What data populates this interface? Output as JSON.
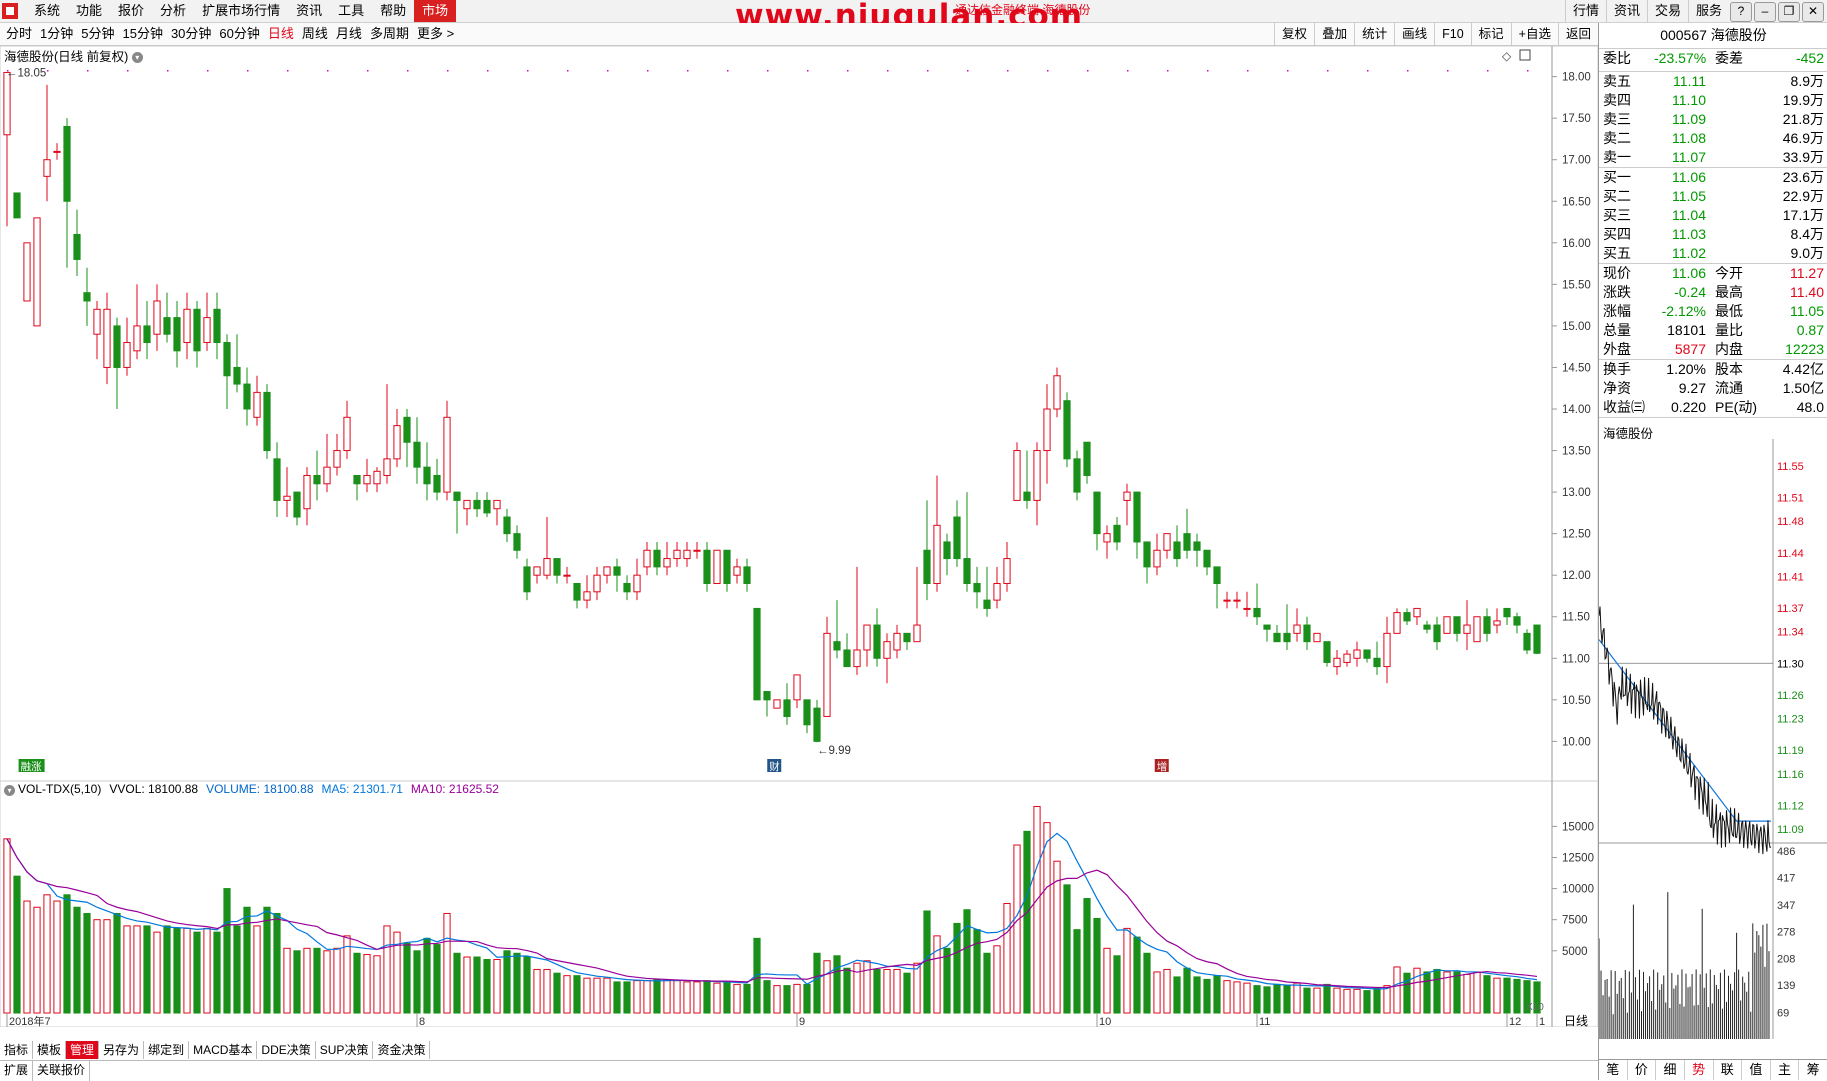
{
  "menu": {
    "items": [
      "系统",
      "功能",
      "报价",
      "分析",
      "扩展市场行情",
      "资讯",
      "工具",
      "帮助",
      "市场"
    ],
    "active": "市场",
    "watermark": "www.niugulan.com",
    "overlay_title": "通达信金融终端 海德股份",
    "right_buttons": [
      "行情",
      "资讯",
      "交易",
      "服务"
    ]
  },
  "toolbar": {
    "periods": [
      "分时",
      "1分钟",
      "5分钟",
      "15分钟",
      "30分钟",
      "60分钟",
      "日线",
      "周线",
      "月线",
      "多周期",
      "更多 >"
    ],
    "active_period": "日线",
    "tools": [
      "复权",
      "叠加",
      "统计",
      "画线",
      "F10",
      "标记",
      "+自选",
      "返回"
    ]
  },
  "chart": {
    "title": "海德股份(日线 前复权)",
    "high_label": "18.05",
    "low_label": "9.99",
    "badges": [
      "融涨",
      "财",
      "增"
    ],
    "month_labels": [
      "2018年7",
      "8",
      "9",
      "10",
      "11",
      "12",
      "1"
    ],
    "period_label": "日线",
    "zoom_label": "X10"
  },
  "chart_data": {
    "type": "candlestick",
    "title": "海德股份(日线 前复权)",
    "price_axis": {
      "min": 9.8,
      "max": 18.2,
      "ticks": [
        "18.00",
        "17.50",
        "17.00",
        "16.50",
        "16.00",
        "15.50",
        "15.00",
        "14.50",
        "14.00",
        "13.50",
        "13.00",
        "12.50",
        "12.00",
        "11.50",
        "11.00",
        "10.50",
        "10.00"
      ]
    },
    "volume_axis": {
      "max": 17200,
      "ticks": [
        "15000",
        "12500",
        "10000",
        "7500",
        "5000"
      ]
    },
    "candles": [
      [
        17.3,
        18.05,
        16.3,
        16.2,
        14000
      ],
      [
        16.6,
        16.3,
        15.9,
        16.7,
        11000
      ],
      [
        15.3,
        16.0,
        14.9,
        15.9,
        9000
      ],
      [
        15.0,
        16.3,
        15.0,
        16.3,
        8500
      ],
      [
        16.8,
        17.0,
        17.9,
        16.5,
        9500
      ],
      [
        17.1,
        17.1,
        17.2,
        17.0,
        9000
      ],
      [
        17.4,
        16.5,
        17.5,
        15.7,
        9500
      ],
      [
        16.1,
        15.8,
        16.4,
        15.6,
        8500
      ],
      [
        15.4,
        15.3,
        15.7,
        15.0,
        8000
      ],
      [
        14.9,
        15.2,
        15.3,
        14.6,
        7500
      ],
      [
        14.5,
        15.2,
        15.4,
        14.3,
        7500
      ],
      [
        15.0,
        14.5,
        15.1,
        14.0,
        8000
      ],
      [
        14.5,
        14.8,
        15.1,
        14.4,
        7000
      ],
      [
        14.7,
        15.0,
        15.5,
        14.6,
        7000
      ],
      [
        15.0,
        14.8,
        15.3,
        14.6,
        7000
      ],
      [
        14.9,
        15.3,
        15.5,
        14.7,
        6500
      ],
      [
        15.1,
        14.9,
        15.4,
        14.8,
        7000
      ],
      [
        15.1,
        14.7,
        15.3,
        14.5,
        6800
      ],
      [
        14.8,
        15.2,
        15.4,
        14.6,
        6800
      ],
      [
        15.2,
        14.7,
        15.3,
        14.5,
        6500
      ],
      [
        14.8,
        15.1,
        15.4,
        14.7,
        6800
      ],
      [
        15.2,
        14.8,
        15.4,
        14.6,
        6500
      ],
      [
        14.8,
        14.4,
        14.9,
        14.0,
        10000
      ],
      [
        14.5,
        14.3,
        14.9,
        14.2,
        7000
      ],
      [
        14.3,
        14.0,
        14.5,
        13.8,
        8500
      ],
      [
        13.9,
        14.2,
        14.4,
        13.8,
        7000
      ],
      [
        14.2,
        13.5,
        14.3,
        13.4,
        8500
      ],
      [
        13.4,
        12.9,
        13.6,
        12.7,
        8000
      ],
      [
        12.9,
        12.95,
        13.3,
        12.7,
        5200
      ],
      [
        13.0,
        12.7,
        13.0,
        12.6,
        5000
      ],
      [
        12.8,
        13.2,
        13.3,
        12.6,
        5200
      ],
      [
        13.2,
        13.1,
        13.5,
        12.9,
        5200
      ],
      [
        13.1,
        13.3,
        13.7,
        13.0,
        5000
      ],
      [
        13.3,
        13.5,
        13.7,
        13.2,
        5200
      ],
      [
        13.5,
        13.9,
        14.1,
        13.4,
        6200
      ],
      [
        13.2,
        13.1,
        13.2,
        12.9,
        4800
      ],
      [
        13.1,
        13.2,
        13.4,
        13.0,
        4700
      ],
      [
        13.1,
        13.25,
        13.3,
        13.0,
        4600
      ],
      [
        13.2,
        13.4,
        14.3,
        13.1,
        7000
      ],
      [
        13.4,
        13.8,
        14.0,
        13.3,
        6500
      ],
      [
        13.9,
        13.6,
        14.0,
        13.3,
        5600
      ],
      [
        13.6,
        13.3,
        13.9,
        13.1,
        5000
      ],
      [
        13.3,
        13.1,
        13.6,
        12.9,
        6000
      ],
      [
        13.2,
        13.0,
        13.4,
        12.9,
        5500
      ],
      [
        13.0,
        13.9,
        14.1,
        12.9,
        8000
      ],
      [
        13.0,
        12.9,
        13.0,
        12.5,
        4800
      ],
      [
        12.8,
        12.9,
        12.9,
        12.6,
        4500
      ],
      [
        12.9,
        12.8,
        13.0,
        12.7,
        4500
      ],
      [
        12.9,
        12.75,
        13.0,
        12.7,
        4300
      ],
      [
        12.8,
        12.9,
        12.9,
        12.6,
        4300
      ],
      [
        12.7,
        12.5,
        12.8,
        12.4,
        5000
      ],
      [
        12.5,
        12.3,
        12.6,
        12.2,
        4800
      ],
      [
        12.1,
        11.8,
        12.2,
        11.7,
        4500
      ],
      [
        12.0,
        12.1,
        12.1,
        11.9,
        3500
      ],
      [
        12.0,
        12.2,
        12.7,
        11.95,
        3500
      ],
      [
        12.2,
        12.0,
        12.2,
        11.9,
        3200
      ],
      [
        12.0,
        12.0,
        12.1,
        11.9,
        3000
      ],
      [
        11.9,
        11.7,
        11.9,
        11.6,
        3000
      ],
      [
        11.7,
        11.8,
        12.0,
        11.6,
        2800
      ],
      [
        11.8,
        12.0,
        12.1,
        11.7,
        2800
      ],
      [
        12.0,
        12.1,
        12.1,
        11.9,
        2800
      ],
      [
        12.1,
        12.0,
        12.2,
        11.8,
        2500
      ],
      [
        11.9,
        11.8,
        12.0,
        11.7,
        2500
      ],
      [
        11.8,
        12.0,
        12.2,
        11.7,
        2600
      ],
      [
        12.1,
        12.3,
        12.4,
        12.0,
        2600
      ],
      [
        12.3,
        12.1,
        12.4,
        12.0,
        2700
      ],
      [
        12.1,
        12.2,
        12.4,
        12.0,
        2600
      ],
      [
        12.2,
        12.3,
        12.4,
        12.1,
        2600
      ],
      [
        12.2,
        12.3,
        12.4,
        12.1,
        2500
      ],
      [
        12.3,
        12.3,
        12.4,
        12.2,
        2500
      ],
      [
        12.3,
        11.9,
        12.4,
        11.8,
        2600
      ],
      [
        11.9,
        12.3,
        12.3,
        11.9,
        2400
      ],
      [
        12.3,
        11.9,
        12.3,
        11.8,
        2500
      ],
      [
        12.0,
        12.1,
        12.2,
        11.9,
        2300
      ],
      [
        12.1,
        11.9,
        12.2,
        11.8,
        2300
      ],
      [
        11.6,
        10.5,
        11.6,
        10.5,
        6000
      ],
      [
        10.6,
        10.5,
        10.6,
        10.3,
        2600
      ],
      [
        10.4,
        10.5,
        10.5,
        10.4,
        2200
      ],
      [
        10.5,
        10.3,
        10.7,
        10.2,
        2200
      ],
      [
        10.5,
        10.8,
        10.8,
        10.4,
        2300
      ],
      [
        10.5,
        10.2,
        10.5,
        10.1,
        2300
      ],
      [
        10.4,
        10.0,
        10.5,
        9.99,
        4800
      ],
      [
        10.3,
        11.3,
        11.5,
        10.3,
        4200
      ],
      [
        11.2,
        11.1,
        11.7,
        11.0,
        4600
      ],
      [
        11.1,
        10.9,
        11.3,
        10.9,
        3600
      ],
      [
        10.9,
        11.1,
        12.1,
        10.8,
        4000
      ],
      [
        11.1,
        11.4,
        11.4,
        10.9,
        4200
      ],
      [
        11.4,
        11.0,
        11.6,
        10.9,
        3500
      ],
      [
        11.0,
        11.2,
        11.3,
        10.7,
        3500
      ],
      [
        11.1,
        11.3,
        11.4,
        11.0,
        3500
      ],
      [
        11.3,
        11.2,
        11.3,
        11.1,
        3200
      ],
      [
        11.2,
        11.4,
        12.1,
        11.2,
        4000
      ],
      [
        12.3,
        11.9,
        12.9,
        11.7,
        8200
      ],
      [
        11.9,
        12.6,
        13.2,
        11.8,
        6200
      ],
      [
        12.4,
        12.2,
        12.5,
        12.0,
        5200
      ],
      [
        12.7,
        12.2,
        12.9,
        12.1,
        7200
      ],
      [
        12.2,
        11.9,
        13.0,
        11.8,
        8300
      ],
      [
        11.9,
        11.8,
        12.1,
        11.6,
        6700
      ],
      [
        11.7,
        11.6,
        12.1,
        11.5,
        4800
      ],
      [
        11.7,
        11.9,
        12.1,
        11.6,
        5400
      ],
      [
        11.9,
        12.2,
        12.4,
        11.8,
        8800
      ],
      [
        12.9,
        13.5,
        13.6,
        12.9,
        13500
      ],
      [
        13.0,
        12.9,
        13.5,
        12.8,
        14600
      ],
      [
        12.9,
        13.5,
        13.6,
        12.6,
        16600
      ],
      [
        13.5,
        14.0,
        14.3,
        13.1,
        15300
      ],
      [
        14.0,
        14.4,
        14.5,
        13.9,
        12200
      ],
      [
        14.1,
        13.4,
        14.2,
        13.3,
        10300
      ],
      [
        13.4,
        13.0,
        13.5,
        12.9,
        6700
      ],
      [
        13.6,
        13.2,
        13.6,
        13.1,
        9200
      ],
      [
        13.0,
        12.5,
        13.0,
        12.3,
        7600
      ],
      [
        12.4,
        12.5,
        12.6,
        12.2,
        5200
      ],
      [
        12.6,
        12.4,
        12.7,
        12.3,
        4600
      ],
      [
        12.9,
        13.0,
        13.1,
        12.6,
        6800
      ],
      [
        13.0,
        12.4,
        13.0,
        12.2,
        6100
      ],
      [
        12.4,
        12.1,
        12.4,
        11.9,
        4800
      ],
      [
        12.1,
        12.3,
        12.5,
        12.0,
        3300
      ],
      [
        12.3,
        12.5,
        12.5,
        12.2,
        3500
      ],
      [
        12.4,
        12.2,
        12.6,
        12.1,
        2900
      ],
      [
        12.5,
        12.3,
        12.8,
        12.2,
        3600
      ],
      [
        12.4,
        12.3,
        12.5,
        12.1,
        2900
      ],
      [
        12.3,
        12.1,
        12.3,
        12.0,
        2700
      ],
      [
        12.1,
        11.9,
        12.1,
        11.6,
        3000
      ],
      [
        11.7,
        11.7,
        11.8,
        11.6,
        2600
      ],
      [
        11.7,
        11.7,
        11.8,
        11.6,
        2500
      ],
      [
        11.6,
        11.6,
        11.8,
        11.5,
        2400
      ],
      [
        11.6,
        11.5,
        11.9,
        11.4,
        2200
      ],
      [
        11.4,
        11.35,
        11.4,
        11.2,
        2100
      ],
      [
        11.3,
        11.2,
        11.4,
        11.2,
        2300
      ],
      [
        11.3,
        11.2,
        11.65,
        11.1,
        2200
      ],
      [
        11.3,
        11.4,
        11.6,
        11.2,
        2400
      ],
      [
        11.4,
        11.2,
        11.5,
        11.1,
        2000
      ],
      [
        11.2,
        11.3,
        11.3,
        11.2,
        2000
      ],
      [
        11.2,
        10.95,
        11.2,
        10.9,
        2300
      ],
      [
        10.9,
        11.0,
        11.1,
        10.8,
        2000
      ],
      [
        10.95,
        11.05,
        11.1,
        10.9,
        1900
      ],
      [
        11.0,
        11.1,
        11.2,
        10.9,
        1900
      ],
      [
        11.1,
        11.0,
        11.1,
        10.95,
        1800
      ],
      [
        11.0,
        10.9,
        11.2,
        10.8,
        2000
      ],
      [
        10.9,
        11.3,
        11.5,
        10.7,
        2200
      ],
      [
        11.3,
        11.55,
        11.6,
        11.3,
        3700
      ],
      [
        11.55,
        11.45,
        11.6,
        11.4,
        3200
      ],
      [
        11.5,
        11.6,
        11.6,
        11.4,
        3600
      ],
      [
        11.4,
        11.35,
        11.45,
        11.3,
        3300
      ],
      [
        11.4,
        11.2,
        11.5,
        11.1,
        3500
      ],
      [
        11.3,
        11.5,
        11.5,
        11.3,
        3300
      ],
      [
        11.5,
        11.3,
        11.5,
        11.2,
        3300
      ],
      [
        11.3,
        11.4,
        11.7,
        11.1,
        3100
      ],
      [
        11.2,
        11.5,
        11.5,
        11.2,
        3300
      ],
      [
        11.5,
        11.3,
        11.6,
        11.2,
        3000
      ],
      [
        11.4,
        11.45,
        11.6,
        11.3,
        2800
      ],
      [
        11.6,
        11.5,
        11.6,
        11.4,
        2800
      ],
      [
        11.5,
        11.4,
        11.55,
        11.3,
        2700
      ],
      [
        11.3,
        11.1,
        11.35,
        11.05,
        2600
      ],
      [
        11.4,
        11.06,
        11.4,
        11.05,
        2500
      ]
    ]
  },
  "volume": {
    "legend_name": "VOL-TDX(5,10)",
    "vvol": "VVOL: 18100.88",
    "volume": "VOLUME: 18100.88",
    "ma5": "MA5: 21301.71",
    "ma10": "MA10: 21625.52",
    "colors": {
      "volume": "#0066cc",
      "ma5": "#0077dd",
      "ma10": "#990099"
    }
  },
  "bottom": {
    "tabs1": [
      "指标",
      "模板",
      "管理",
      "另存为",
      "绑定到",
      "MACD基本",
      "DDE决策",
      "SUP决策",
      "资金决策"
    ],
    "active_tab1": "管理",
    "tabs2": [
      "扩展",
      "关联报价"
    ]
  },
  "quote": {
    "code_name": "000567 海德股份",
    "weibi_label": "委比",
    "weibi": "-23.57%",
    "weicha_label": "委差",
    "weicha": "-452",
    "sells": [
      {
        "label": "卖五",
        "price": "11.11",
        "vol": "8.9万"
      },
      {
        "label": "卖四",
        "price": "11.10",
        "vol": "19.9万"
      },
      {
        "label": "卖三",
        "price": "11.09",
        "vol": "21.8万"
      },
      {
        "label": "卖二",
        "price": "11.08",
        "vol": "46.9万"
      },
      {
        "label": "卖一",
        "price": "11.07",
        "vol": "33.9万"
      }
    ],
    "buys": [
      {
        "label": "买一",
        "price": "11.06",
        "vol": "23.6万"
      },
      {
        "label": "买二",
        "price": "11.05",
        "vol": "22.9万"
      },
      {
        "label": "买三",
        "price": "11.04",
        "vol": "17.1万"
      },
      {
        "label": "买四",
        "price": "11.03",
        "vol": "8.4万"
      },
      {
        "label": "买五",
        "price": "11.02",
        "vol": "9.0万"
      }
    ],
    "stats": [
      {
        "l1": "现价",
        "v1": "11.06",
        "c1": "g",
        "l2": "今开",
        "v2": "11.27",
        "c2": "r"
      },
      {
        "l1": "涨跌",
        "v1": "-0.24",
        "c1": "g",
        "l2": "最高",
        "v2": "11.40",
        "c2": "r"
      },
      {
        "l1": "涨幅",
        "v1": "-2.12%",
        "c1": "g",
        "l2": "最低",
        "v2": "11.05",
        "c2": "g"
      },
      {
        "l1": "总量",
        "v1": "18101",
        "c1": "",
        "l2": "量比",
        "v2": "0.87",
        "c2": "g"
      },
      {
        "l1": "外盘",
        "v1": "5877",
        "c1": "r",
        "l2": "内盘",
        "v2": "12223",
        "c2": "g"
      }
    ],
    "stats2": [
      {
        "l1": "换手",
        "v1": "1.20%",
        "l2": "股本",
        "v2": "4.42亿"
      },
      {
        "l1": "净资",
        "v1": "9.27",
        "l2": "流通",
        "v2": "1.50亿"
      },
      {
        "l1": "收益㈢",
        "v1": "0.220",
        "l2": "PE(动)",
        "v2": "48.0"
      }
    ]
  },
  "mini": {
    "title": "海德股份",
    "price_ticks": [
      "11.55",
      "11.51",
      "11.48",
      "11.44",
      "11.41",
      "11.37",
      "11.34",
      "11.30",
      "11.26",
      "11.23",
      "11.19",
      "11.16",
      "11.12",
      "11.09"
    ],
    "vol_ticks": [
      "486",
      "417",
      "347",
      "278",
      "208",
      "139",
      "69"
    ],
    "tabs": [
      "笔",
      "价",
      "细",
      "势",
      "联",
      "值",
      "主",
      "筹"
    ],
    "active_tab": "势"
  }
}
